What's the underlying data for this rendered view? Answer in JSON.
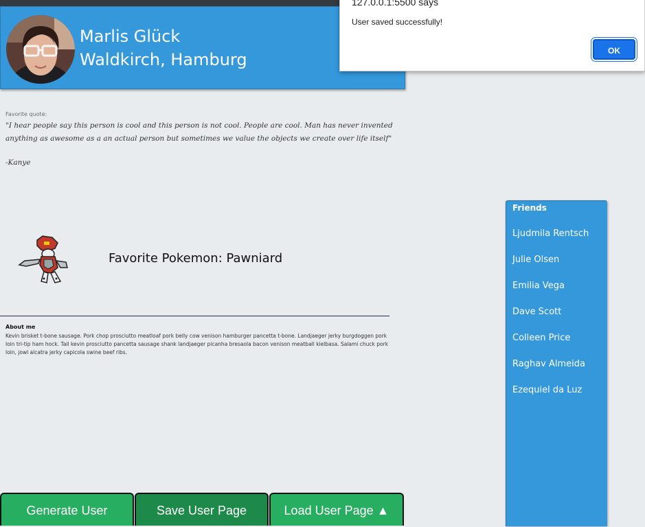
{
  "profile": {
    "name": "Marlis Glück",
    "location": "Waldkirch, Hamburg"
  },
  "quote": {
    "label": "Favorite quote:",
    "text": "\"I hear people say this person is cool and this person is not cool. People are cool. Man has never invented anything as awesome as a an actual person but sometimes we value the objects we create over life itself\"",
    "author": "-Kanye"
  },
  "pokemon": {
    "label": "Favorite Pokemon: Pawniard"
  },
  "about": {
    "title": "About me",
    "text": "Kevin brisket t-bone sausage. Pork chop prosciutto meatloaf pork belly cow venison hamburger pancetta t-bone. Landjaeger jerky burgdoggen pork loin tri-tip ham hock. Tail kevin prosciutto pancetta sausage shank landjaeger picanha bresaola bacon venison meatball kielbasa. Salami chuck pork loin, jowl alcatra jerky capicola swine beef ribs."
  },
  "friends": {
    "title": "Friends",
    "items": [
      "Ljudmila Rentsch",
      "Julie Olsen",
      "Emilia Vega",
      "Dave Scott",
      "Colleen Price",
      "Raghav Almeida",
      "Ezequiel da Luz"
    ]
  },
  "buttons": {
    "generate": "Generate User",
    "save": "Save User Page",
    "load": "Load User Page ▲"
  },
  "alert": {
    "title": "127.0.0.1:5500 says",
    "message": "User saved successfully!",
    "ok": "OK"
  },
  "colors": {
    "header_blue": "#3498db",
    "button_green": "#27ae60",
    "button_green_active": "#1e8a4a",
    "alert_ok_blue": "#1a73e8"
  },
  "icons": {
    "avatar": "avatar-photo",
    "pokemon": "pawniard-sprite"
  }
}
